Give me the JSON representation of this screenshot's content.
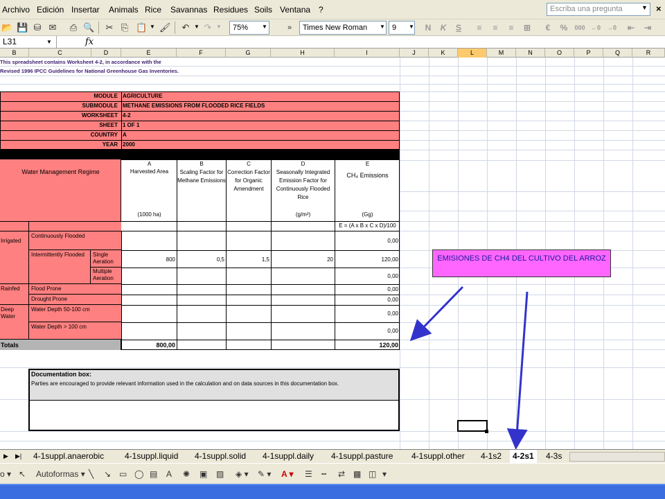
{
  "menu": {
    "items": [
      "Archivo",
      "Edición",
      "Insertar",
      "Animals",
      "Rice",
      "Savannas",
      "Residues",
      "Soils",
      "Ventana",
      "?"
    ],
    "help_placeholder": "Escriba una pregunta"
  },
  "toolbar": {
    "zoom": "75%",
    "font_name": "Times New Roman",
    "font_size": "9"
  },
  "formula_bar": {
    "name_box": "L31",
    "fx": "fx"
  },
  "columns": [
    "B",
    "C",
    "D",
    "E",
    "F",
    "G",
    "H",
    "I",
    "J",
    "K",
    "L",
    "M",
    "N",
    "O",
    "P",
    "Q",
    "R"
  ],
  "selected_column": "L",
  "notes": {
    "line1": "This spreadsheet contains Worksheet 4-2, in accordance with the",
    "line2": "Revised 1996 IPCC Guidelines for National Greenhouse Gas Inventories."
  },
  "header_block": {
    "module_label": "MODULE",
    "module_value": "AGRICULTURE",
    "submodule_label": "SUBMODULE",
    "submodule_value": "METHANE EMISSIONS FROM FLOODED RICE FIELDS",
    "worksheet_label": "WORKSHEET",
    "worksheet_value": "4-2",
    "sheet_label": "SHEET",
    "sheet_value": "1 OF 1",
    "country_label": "COUNTRY",
    "country_value": "A",
    "year_label": "YEAR",
    "year_value": "2000"
  },
  "table": {
    "regime_header": "Water Management Regime",
    "col_a_letter": "A",
    "col_a_title": "Harvested Area",
    "col_a_unit": "(1000 ha)",
    "col_b_letter": "B",
    "col_b_title": "Scaling Factor for Methane Emissions",
    "col_c_letter": "C",
    "col_c_title": "Correction Factor for Organic Amendment",
    "col_d_letter": "D",
    "col_d_title": "Seasonally Integrated Emission Factor for Continuously Flooded Rice",
    "col_d_unit": "(g/m²)",
    "col_e_letter": "E",
    "col_e_title": "CH₄ Emissions",
    "col_e_unit": "(Gg)",
    "formula": "E = (A x B x C x D)/100",
    "irrigated": "Irrigated",
    "continuously_flooded": "Continuously Flooded",
    "intermittently_flooded": "Intermittently Flooded",
    "single_aeration": "Single Aeration",
    "multiple_aeration": "Multiple Aeration",
    "rainfed": "Rainfed",
    "flood_prone": "Flood Prone",
    "drought_prone": "Drought Prone",
    "deep_water": "Deep Water",
    "water_depth_50_100": "Water Depth 50-100 cm",
    "water_depth_100": "Water Depth > 100 cm",
    "totals_label": "Totals",
    "e_continuous": "0,00",
    "a_single": "800",
    "b_single": "0,5",
    "c_single": "1,5",
    "d_single": "20",
    "e_single": "120,00",
    "e_multiple": "0,00",
    "e_flood": "0,00",
    "e_drought": "0,00",
    "e_depth1": "0,00",
    "e_depth2": "0,00",
    "total_a": "800,00",
    "total_e": "120,00"
  },
  "doc_box": {
    "title": "Documentation box:",
    "text": "Parties are encouraged to provide relevant information used in the calculation and on data sources in this documentation box."
  },
  "callout": "EMISIONES DE CH4 DEL CULTIVO DEL ARROZ",
  "sheet_tabs": [
    "4-1suppl.anaerobic",
    "4-1suppl.liquid",
    "4-1suppl.solid",
    "4-1suppl.daily",
    "4-1suppl.pasture",
    "4-1suppl.other",
    "4-1s2",
    "4-2s1",
    "4-3s"
  ],
  "active_tab": "4-2s1",
  "draw_toolbar": {
    "autoformas": "Autoformas"
  },
  "colors": {
    "header_fill": "#ff8080",
    "callout_fill": "#ff66ff",
    "arrow": "#3333cc"
  }
}
